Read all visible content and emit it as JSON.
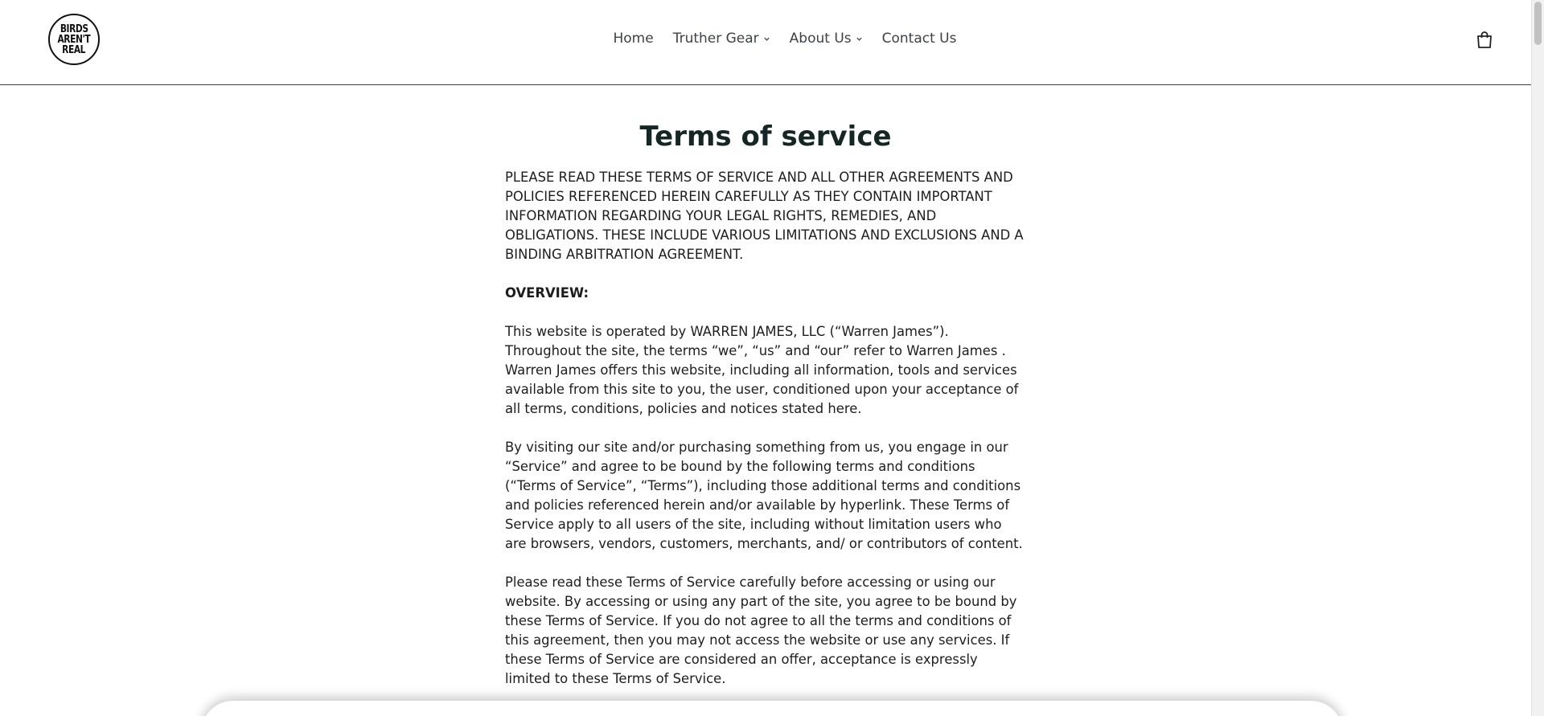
{
  "header": {
    "logo_lines": [
      "BIRDS",
      "AREN'T",
      "REAL"
    ],
    "nav": [
      {
        "label": "Home",
        "dropdown": false
      },
      {
        "label": "Truther Gear",
        "dropdown": true
      },
      {
        "label": "About Us",
        "dropdown": true
      },
      {
        "label": "Contact Us",
        "dropdown": false
      }
    ],
    "cart_icon": "shopping-bag-icon"
  },
  "main": {
    "title": "Terms of service",
    "paragraphs": [
      "PLEASE READ THESE TERMS OF SERVICE AND ALL OTHER AGREEMENTS AND POLICIES REFERENCED HEREIN CAREFULLY AS THEY CONTAIN IMPORTANT INFORMATION REGARDING YOUR LEGAL RIGHTS, REMEDIES, AND OBLIGATIONS. THESE INCLUDE VARIOUS LIMITATIONS AND EXCLUSIONS AND A BINDING ARBITRATION AGREEMENT.",
      "OVERVIEW:",
      "This website is operated by WARREN JAMES, LLC (“Warren James”). Throughout the site, the terms “we”, “us” and “our” refer to Warren James . Warren James offers this website, including all information, tools and services available from this site to you, the user, conditioned upon your acceptance of all terms, conditions, policies and notices stated here.",
      "By visiting our site and/or purchasing something from us, you engage in our “Service” and agree to be bound by the following terms and conditions (“Terms of Service”, “Terms”), including those additional terms and conditions and policies referenced herein and/or available by hyperlink. These Terms of Service apply to all users of the site, including without limitation users who are browsers, vendors, customers, merchants, and/ or contributors of content.",
      "Please read these Terms of Service carefully before accessing or using our website. By accessing or using any part of the site, you agree to be bound by these Terms of Service. If you do not agree to all the terms and conditions of this agreement, then you may not access the website or use any services. If these Terms of Service are considered an offer, acceptance is expressly limited to these Terms of Service."
    ]
  },
  "colors": {
    "title": "#152725",
    "text": "#1c1d1d",
    "nav_text": "#3d4246",
    "header_border": "#3a3a3a"
  }
}
